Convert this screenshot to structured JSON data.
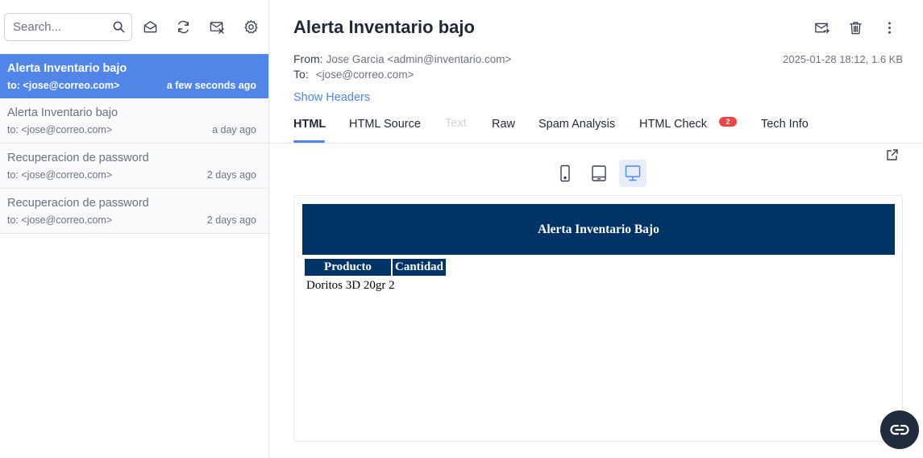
{
  "sidebar": {
    "search": {
      "placeholder": "Search...",
      "value": ""
    },
    "toolbar_icons": [
      "search-icon",
      "envelope-open-icon",
      "refresh-icon",
      "clear-inbox-icon",
      "gear-icon"
    ],
    "messages": [
      {
        "subject": "Alerta Inventario bajo",
        "to": "to: <jose@correo.com>",
        "time": "a few seconds ago",
        "active": true
      },
      {
        "subject": "Alerta Inventario bajo",
        "to": "to: <jose@correo.com>",
        "time": "a day ago",
        "active": false
      },
      {
        "subject": "Recuperacion de password",
        "to": "to: <jose@correo.com>",
        "time": "2 days ago",
        "active": false
      },
      {
        "subject": "Recuperacion de password",
        "to": "to: <jose@correo.com>",
        "time": "2 days ago",
        "active": false
      }
    ]
  },
  "message": {
    "subject": "Alerta Inventario bajo",
    "from_label": "From:",
    "from_value": "Jose Garcia <admin@inventario.com>",
    "to_label": "To:",
    "to_value": "<jose@correo.com>",
    "meta": "2025-01-28 18:12, 1.6 KB",
    "show_headers": "Show Headers",
    "actions": [
      "forward-icon",
      "trash-icon",
      "more-vert-icon"
    ]
  },
  "tabs": [
    {
      "label": "HTML",
      "state": "active"
    },
    {
      "label": "HTML Source",
      "state": "normal"
    },
    {
      "label": "Text",
      "state": "disabled"
    },
    {
      "label": "Raw",
      "state": "normal"
    },
    {
      "label": "Spam Analysis",
      "state": "normal"
    },
    {
      "label": "HTML Check",
      "state": "normal",
      "badge": "2"
    },
    {
      "label": "Tech Info",
      "state": "normal"
    }
  ],
  "preview": {
    "devices": [
      "phone-icon",
      "tablet-icon",
      "desktop-icon"
    ],
    "active_device": "desktop",
    "email": {
      "banner": "Alerta Inventario Bajo",
      "table_headers": [
        "Producto",
        "Cantidad"
      ],
      "row_text": "Doritos 3D 20gr 2"
    }
  },
  "colors": {
    "accent": "#4f86e8",
    "email_header_bg": "#003366",
    "badge": "#ef4444",
    "fab_bg": "#1f2d3d"
  }
}
